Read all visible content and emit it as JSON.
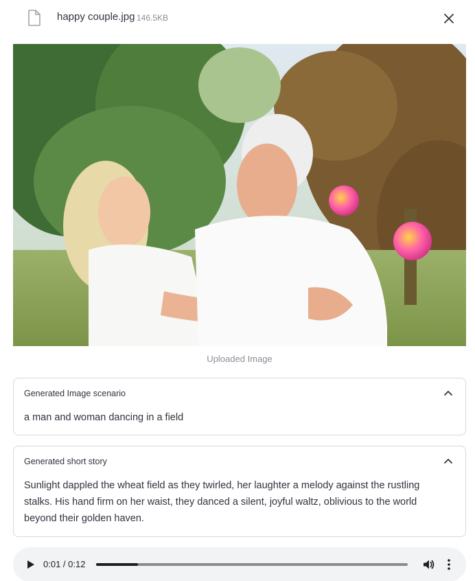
{
  "file": {
    "name": "happy couple.jpg",
    "size": "146.5KB",
    "icon": "file-icon",
    "close_icon": "close-icon"
  },
  "image": {
    "caption": "Uploaded Image"
  },
  "expanders": [
    {
      "title": "Generated Image scenario",
      "content": "a man and woman dancing in a field"
    },
    {
      "title": "Generated short story",
      "content": "Sunlight dappled the wheat field as they twirled, her laughter a melody against the rustling stalks. His hand firm on her waist, they danced a silent, joyful waltz, oblivious to the world beyond their golden haven."
    }
  ],
  "audio": {
    "time_display": "0:01 / 0:12",
    "progress": 0.135
  },
  "colors": {
    "text": "#31333f",
    "muted": "#8b8d96",
    "border": "#d6d7dc",
    "player_bg": "#f1f3f4"
  }
}
